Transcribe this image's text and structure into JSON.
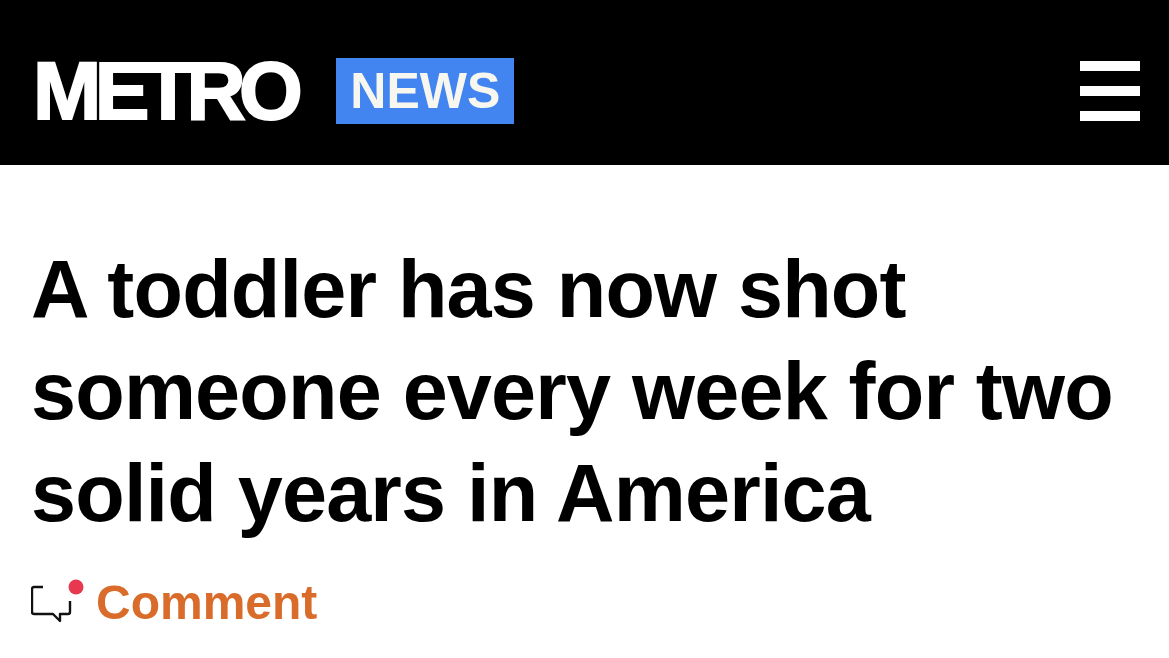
{
  "header": {
    "logo": "METRO",
    "section_badge": "NEWS"
  },
  "article": {
    "headline": "A toddler has now shot someone every week for two solid years in America"
  },
  "comment_link": {
    "label": "Comment"
  }
}
